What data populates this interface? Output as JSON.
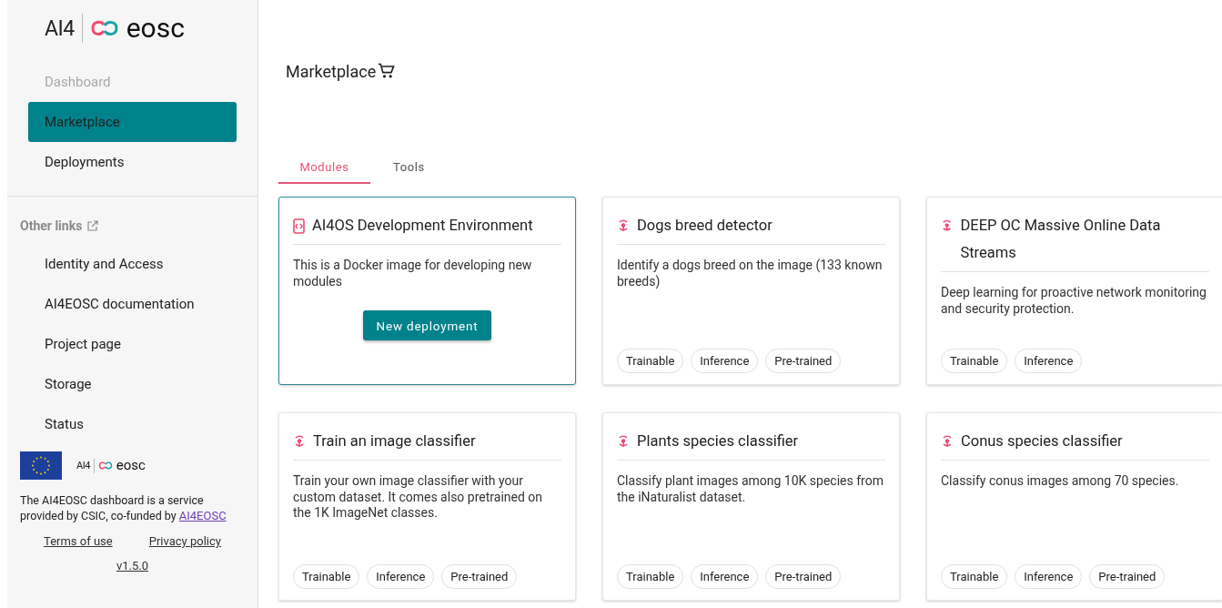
{
  "logo": {
    "left": "AI4",
    "right": "eosc"
  },
  "nav": [
    {
      "label": "Dashboard",
      "selected": false,
      "disabled": true
    },
    {
      "label": "Marketplace",
      "selected": true,
      "disabled": false
    },
    {
      "label": "Deployments",
      "selected": false,
      "disabled": false
    }
  ],
  "other_links": {
    "title": "Other links",
    "items": [
      "Identity and Access",
      "AI4EOSC documentation",
      "Project page",
      "Storage",
      "Status"
    ]
  },
  "footer": {
    "logo": {
      "left": "AI4",
      "right": "eosc"
    },
    "text": "The AI4EOSC dashboard is a service provided by CSIC, co-funded by",
    "link": "AI4EOSC",
    "links": [
      "Terms of use",
      "Privacy policy"
    ],
    "version": "v1.5.0"
  },
  "page_title": "Marketplace",
  "tabs": [
    {
      "label": "Modules",
      "selected": true
    },
    {
      "label": "Tools",
      "selected": false
    }
  ],
  "cards": [
    {
      "kind": "dev",
      "title": "AI4OS Development Environment",
      "description": "This is a Docker image for developing new modules",
      "button": "New deployment"
    },
    {
      "kind": "module",
      "title": "Dogs breed detector",
      "description": "Identify a dogs breed on the image (133 known breeds)",
      "tags": [
        "Trainable",
        "Inference",
        "Pre-trained"
      ]
    },
    {
      "kind": "module",
      "title": "DEEP OC Massive Online Data Streams",
      "description": "Deep learning for proactive network monitoring and security protection.",
      "tags": [
        "Trainable",
        "Inference"
      ]
    },
    {
      "kind": "module",
      "title": "Train an image classifier",
      "description": "Train your own image classifier with your custom dataset. It comes also pretrained on the 1K ImageNet classes.",
      "tags": [
        "Trainable",
        "Inference",
        "Pre-trained"
      ]
    },
    {
      "kind": "module",
      "title": "Plants species classifier",
      "description": "Classify plant images among 10K species from the iNaturalist dataset.",
      "tags": [
        "Trainable",
        "Inference",
        "Pre-trained"
      ]
    },
    {
      "kind": "module",
      "title": "Conus species classifier",
      "description": "Classify conus images among 70 species.",
      "tags": [
        "Trainable",
        "Inference",
        "Pre-trained"
      ]
    }
  ]
}
